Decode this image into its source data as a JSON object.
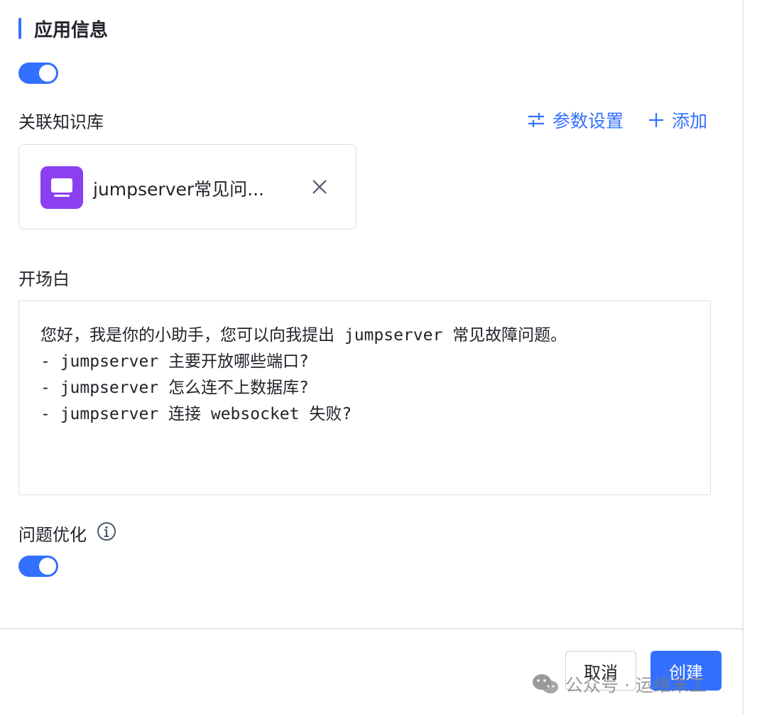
{
  "section": {
    "title": "应用信息"
  },
  "toggles": {
    "top_enabled": true,
    "question_optimize_enabled": true
  },
  "knowledge": {
    "label": "关联知识库",
    "param_settings_label": "参数设置",
    "add_label": "添加",
    "items": [
      {
        "name": "jumpserver常见问..."
      }
    ]
  },
  "prologue": {
    "label": "开场白",
    "text": "您好，我是你的小助手，您可以向我提出 jumpserver 常见故障问题。\n- jumpserver 主要开放哪些端口?\n- jumpserver 怎么连不上数据库?\n- jumpserver 连接 websocket 失败?"
  },
  "question_optimize": {
    "label": "问题优化"
  },
  "footer": {
    "cancel_label": "取消",
    "create_label": "创建"
  },
  "watermark": {
    "text": "公众号 · 运维未工"
  },
  "colors": {
    "accent": "#3370ff",
    "kb_icon": "#8b3ff0"
  }
}
